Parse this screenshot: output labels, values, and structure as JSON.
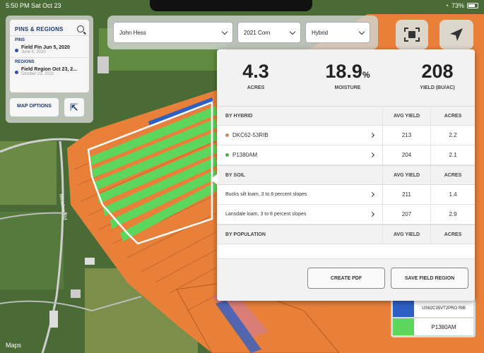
{
  "status": {
    "time_date": "5:50 PM  Sat Oct 23",
    "battery": "73%"
  },
  "pins_panel": {
    "title": "PINS & REGIONS",
    "pins_label": "PINS",
    "pins": [
      {
        "name": "Field Pin Jun 5, 2020",
        "date": "June 5, 2020"
      }
    ],
    "regions_label": "REGIONS",
    "regions": [
      {
        "name": "Field Region Oct 23, 2...",
        "date": "October 23, 2021"
      }
    ],
    "map_options": "MAP OPTIONS"
  },
  "filters": {
    "grower": "John Hess",
    "season": "2021 Corn",
    "layer": "Hybrid"
  },
  "stats": {
    "acres_value": "4.3",
    "acres_label": "ACRES",
    "moisture_value": "18.9",
    "moisture_unit": "%",
    "moisture_label": "MOISTURE",
    "yield_value": "208",
    "yield_label": "YIELD (BU/AC)"
  },
  "by_hybrid": {
    "header": "BY HYBRID",
    "col_yield": "AVG YIELD",
    "col_acres": "ACRES",
    "rows": [
      {
        "name": "DKC62-53RIB",
        "avg_yield": "213",
        "acres": "2.2",
        "color": "#c98a5a"
      },
      {
        "name": "P1380AM",
        "avg_yield": "204",
        "acres": "2.1",
        "color": "#4caf50"
      }
    ]
  },
  "by_soil": {
    "header": "BY SOIL",
    "col_yield": "AVG YIELD",
    "col_acres": "ACRES",
    "rows": [
      {
        "name": "Bucks silt loam, 3 to 8 percent slopes",
        "avg_yield": "211",
        "acres": "1.4"
      },
      {
        "name": "Lansdale loam, 3 to 8 percent slopes",
        "avg_yield": "207",
        "acres": "2.9"
      }
    ]
  },
  "by_population": {
    "header": "BY POPULATION",
    "col_yield": "AVG YIELD",
    "col_acres": "ACRES"
  },
  "footer": {
    "create_pdf": "CREATE PDF",
    "save_region": "SAVE FIELD REGION"
  },
  "legend": [
    {
      "label": "US62C35VT2PRO RIB",
      "color": "#2e5fc4"
    },
    {
      "label": "P1380AM",
      "color": "#5cd65c"
    }
  ],
  "credit": "Maps",
  "colors": {
    "field_orange": "#e8803a",
    "hybrid_green": "#5cd65c",
    "hybrid_blue": "#2e5fc4",
    "accent_navy": "#1f3b6f"
  }
}
